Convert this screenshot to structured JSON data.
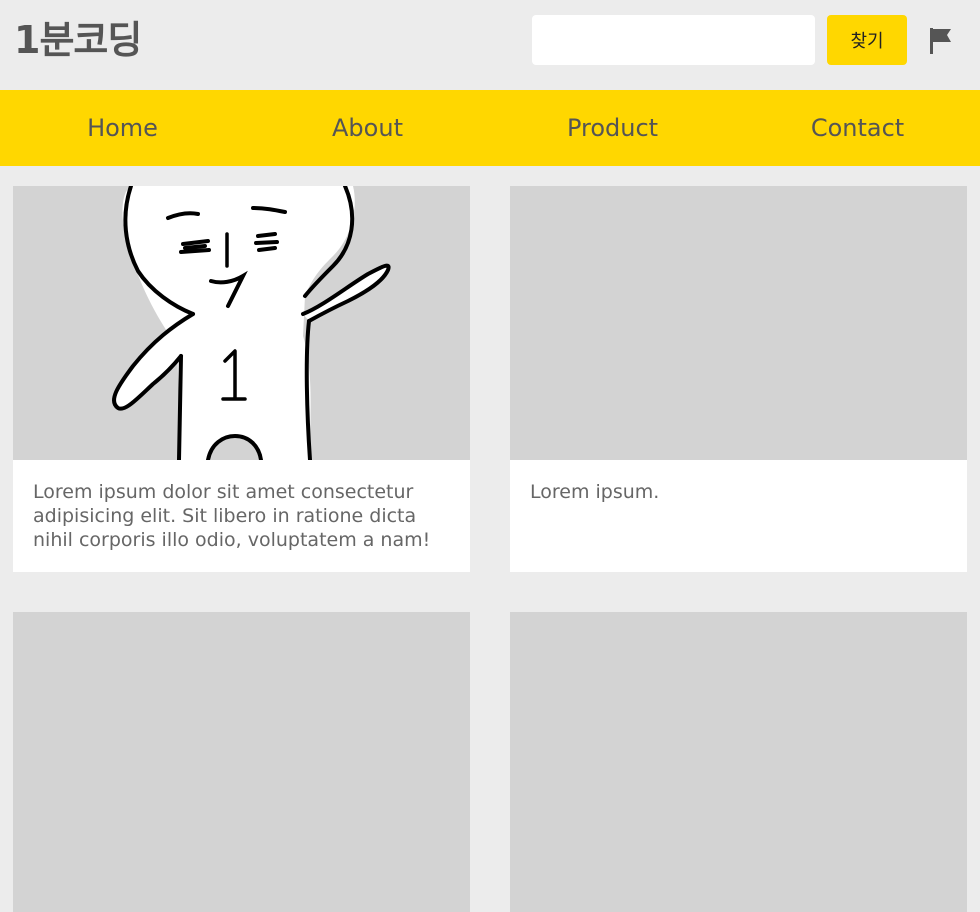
{
  "header": {
    "logo": "1분코딩",
    "search": {
      "value": "",
      "placeholder": ""
    },
    "search_button": "찾기",
    "flag_icon": "flag-icon"
  },
  "nav": {
    "items": [
      {
        "label": "Home"
      },
      {
        "label": "About"
      },
      {
        "label": "Product"
      },
      {
        "label": "Contact"
      }
    ]
  },
  "cards": [
    {
      "text": "Lorem ipsum dolor sit amet consectetur adipisicing elit. Sit libero in ratione dicta nihil corporis illo odio, voluptatem a nam!",
      "image": "mascot-illustration"
    },
    {
      "text": "Lorem ipsum.",
      "image": "placeholder"
    },
    {
      "text": "",
      "image": "placeholder"
    },
    {
      "text": "",
      "image": "placeholder"
    }
  ],
  "colors": {
    "background": "#ececec",
    "accent": "#ffd700",
    "text": "#555555",
    "image_placeholder": "#d3d3d3"
  }
}
